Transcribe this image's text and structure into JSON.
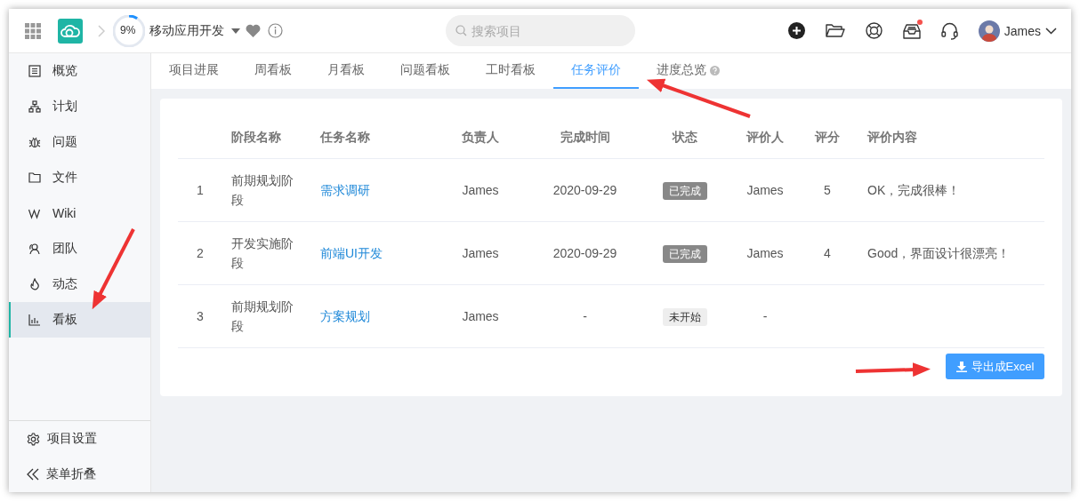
{
  "header": {
    "progress": {
      "level": 0.09,
      "text": "9%"
    },
    "project_name": "移动应用开发",
    "search": {
      "placeholder": "搜索项目"
    },
    "notification_dot": true,
    "user_name": "James"
  },
  "sidebar": {
    "items": [
      {
        "label": "概览",
        "selected": false
      },
      {
        "label": "计划",
        "selected": false
      },
      {
        "label": "问题",
        "selected": false
      },
      {
        "label": "文件",
        "selected": false
      },
      {
        "label": "Wiki",
        "selected": false
      },
      {
        "label": "团队",
        "selected": false
      },
      {
        "label": "动态",
        "selected": false
      },
      {
        "label": "看板",
        "selected": true
      }
    ],
    "footer": [
      {
        "label": "项目设置"
      },
      {
        "label": "菜单折叠"
      }
    ]
  },
  "tabs": [
    {
      "label": "项目进展",
      "selected": false,
      "help": false
    },
    {
      "label": "周看板",
      "selected": false,
      "help": false
    },
    {
      "label": "月看板",
      "selected": false,
      "help": false
    },
    {
      "label": "问题看板",
      "selected": false,
      "help": false
    },
    {
      "label": "工时看板",
      "selected": false,
      "help": false
    },
    {
      "label": "任务评价",
      "selected": true,
      "help": false
    },
    {
      "label": "进度总览",
      "selected": false,
      "help": true
    }
  ],
  "table": {
    "columns": [
      "",
      "阶段名称",
      "任务名称",
      "负责人",
      "完成时间",
      "状态",
      "评价人",
      "评分",
      "评价内容"
    ],
    "rows": [
      {
        "index": "1",
        "stage": "前期规划阶段",
        "task": "需求调研",
        "owner": "James",
        "finished": "2020-09-29",
        "status": {
          "text": "已完成",
          "kind": "done"
        },
        "reviewer": "James",
        "score": "5",
        "comment": "OK，完成很棒！"
      },
      {
        "index": "2",
        "stage": "开发实施阶段",
        "task": "前端UI开发",
        "owner": "James",
        "finished": "2020-09-29",
        "status": {
          "text": "已完成",
          "kind": "done"
        },
        "reviewer": "James",
        "score": "4",
        "comment": "Good，界面设计很漂亮！"
      },
      {
        "index": "3",
        "stage": "前期规划阶段",
        "task": "方案规划",
        "owner": "James",
        "finished": "-",
        "status": {
          "text": "未开始",
          "kind": "todo"
        },
        "reviewer": "-"
      }
    ]
  },
  "export_button": "导出成Excel"
}
